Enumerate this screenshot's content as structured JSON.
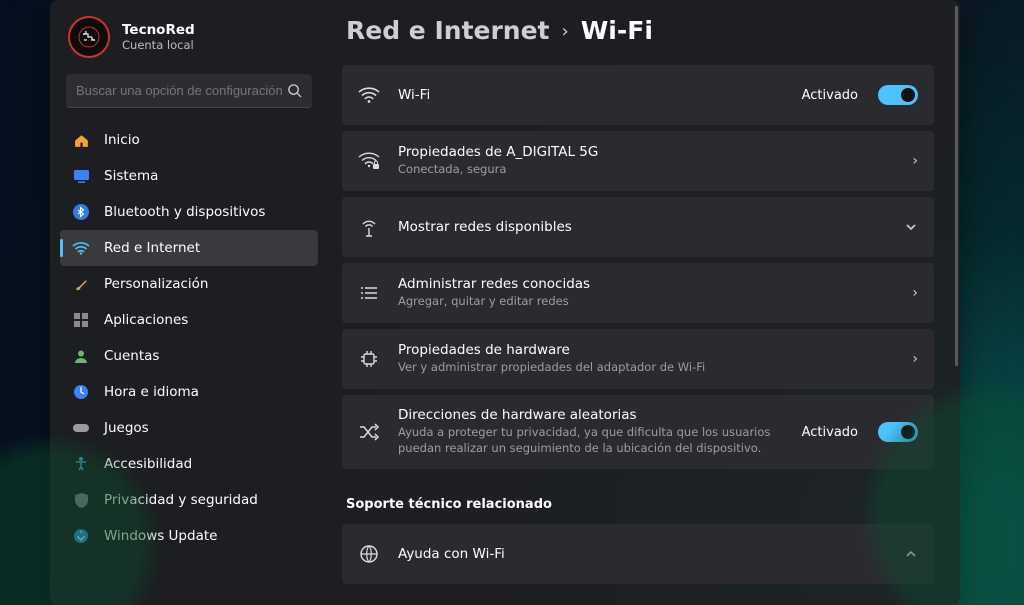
{
  "profile": {
    "name": "TecnoRed",
    "subtitle": "Cuenta local"
  },
  "search": {
    "placeholder": "Buscar una opción de configuración"
  },
  "sidebar": {
    "items": [
      {
        "label": "Inicio"
      },
      {
        "label": "Sistema"
      },
      {
        "label": "Bluetooth y dispositivos"
      },
      {
        "label": "Red e Internet"
      },
      {
        "label": "Personalización"
      },
      {
        "label": "Aplicaciones"
      },
      {
        "label": "Cuentas"
      },
      {
        "label": "Hora e idioma"
      },
      {
        "label": "Juegos"
      },
      {
        "label": "Accesibilidad"
      },
      {
        "label": "Privacidad y seguridad"
      },
      {
        "label": "Windows Update"
      }
    ]
  },
  "breadcrumb": {
    "parent": "Red e Internet",
    "current": "Wi-Fi"
  },
  "cards": {
    "wifi": {
      "title": "Wi-Fi",
      "status": "Activado"
    },
    "props": {
      "title": "Propiedades de A_DIGITAL 5G",
      "sub": "Conectada, segura"
    },
    "show": {
      "title": "Mostrar redes disponibles"
    },
    "known": {
      "title": "Administrar redes conocidas",
      "sub": "Agregar, quitar y editar redes"
    },
    "hw": {
      "title": "Propiedades de hardware",
      "sub": "Ver y administrar propiedades del adaptador de Wi-Fi"
    },
    "randmac": {
      "title": "Direcciones de hardware aleatorias",
      "sub": "Ayuda a proteger tu privacidad, ya que dificulta que los usuarios puedan realizar un seguimiento de la ubicación del dispositivo.",
      "status": "Activado"
    }
  },
  "support": {
    "heading": "Soporte técnico relacionado",
    "help_wifi": "Ayuda con Wi-Fi"
  }
}
